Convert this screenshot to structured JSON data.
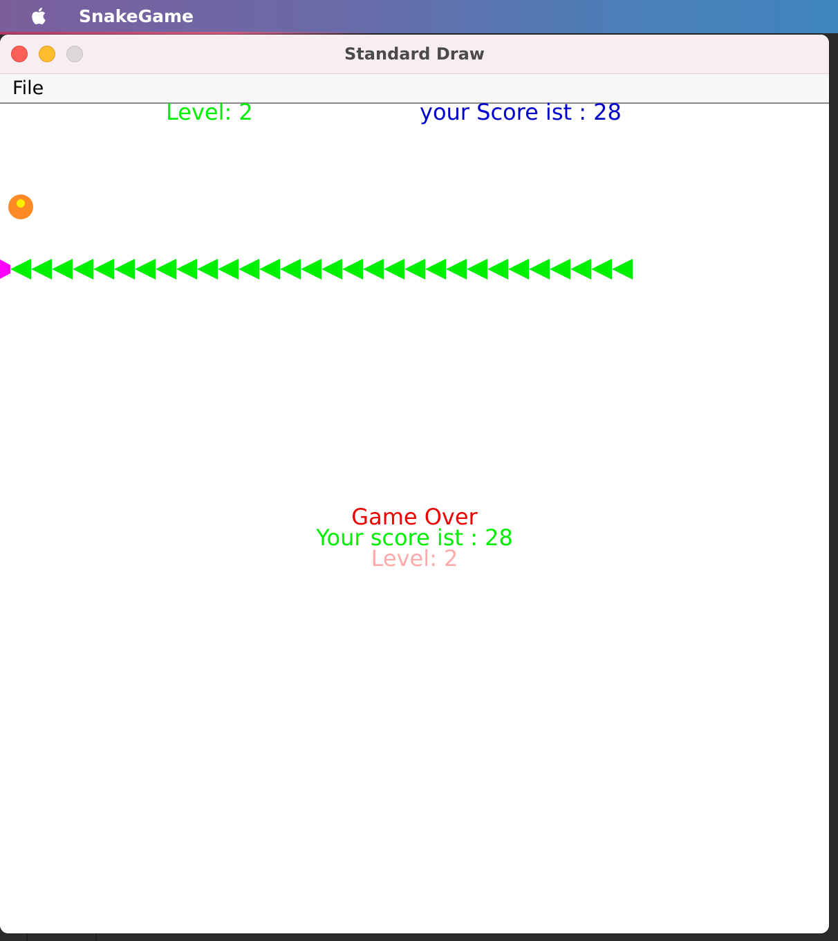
{
  "menubar": {
    "app_name": "SnakeGame",
    "icon": "apple-icon"
  },
  "window": {
    "title": "Standard Draw",
    "menu": {
      "file_label": "File"
    }
  },
  "hud": {
    "level_text": "Level: 2",
    "score_text": "your Score ist : 28",
    "level_color": "#00ee00",
    "score_color": "#0000cc"
  },
  "game_over": {
    "title": "Game Over",
    "score_text": "Your score ist : 28",
    "level_text": "Level: 2",
    "title_color": "#ee0000",
    "score_color": "#00ee00",
    "level_color": "#ffaaaa"
  },
  "game": {
    "snake_color": "#00ee00",
    "head_color": "#ff00ff",
    "snake_segments": 30,
    "direction": "left",
    "food_color": "#ff8a25",
    "food_center_color": "#ffee00"
  }
}
